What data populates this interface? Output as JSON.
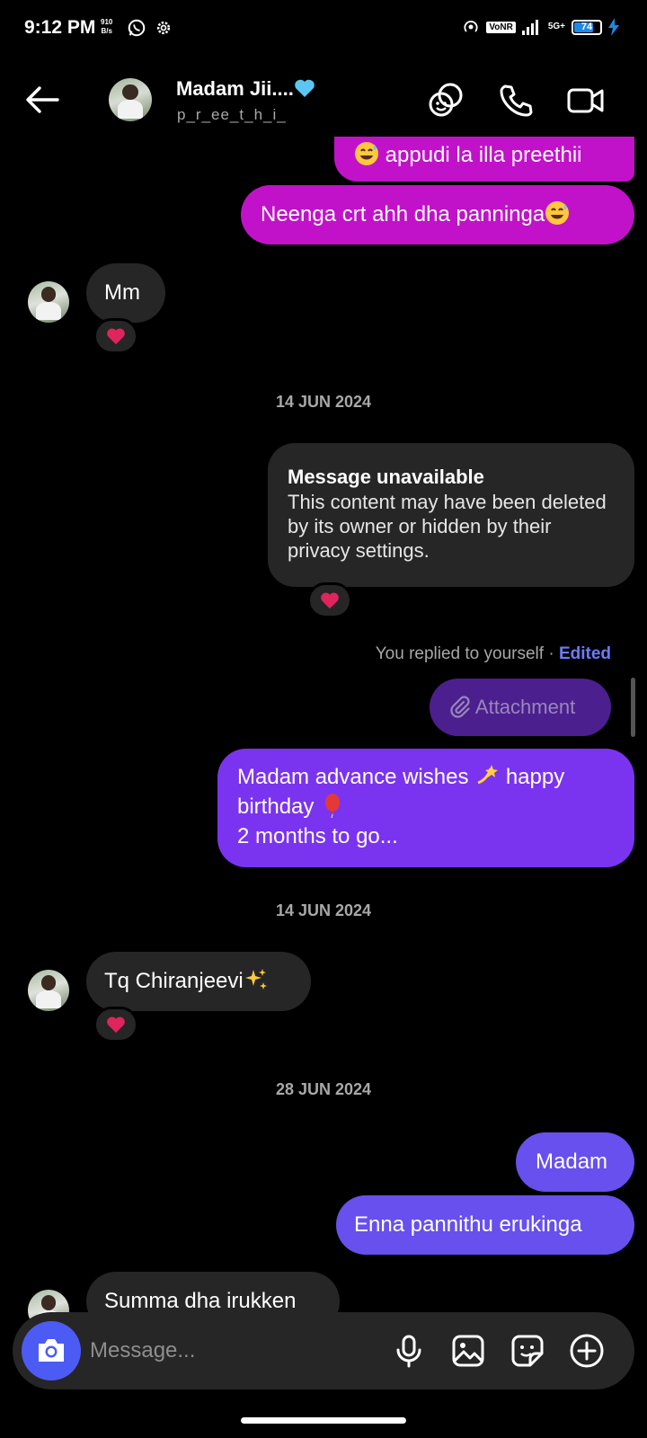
{
  "status_bar": {
    "time": "9:12 PM",
    "net_speed_top": "910",
    "net_speed_bottom": "B/s",
    "volte": "VoNR",
    "network": "5G+",
    "battery": "74"
  },
  "header": {
    "name": "Madam Jii....",
    "username": "p_r_ee_t_h_i_"
  },
  "messages": [
    {
      "text": "appudi la illa preethii"
    },
    {
      "text": "Neenga crt ahh dha panninga"
    },
    {
      "text": "Mm"
    },
    {
      "date": "14 JUN 2024"
    },
    {
      "title": "Message unavailable",
      "text": "This content may have been deleted by its owner or hidden by their privacy settings."
    },
    {
      "reply_note": "You replied to yourself",
      "separator": "·",
      "edited": "Edited"
    },
    {
      "text": "Attachment"
    },
    {
      "line1": "Madam advance wishes",
      "line1b": "happy",
      "line2": "birthday",
      "line3": "2 months to go..."
    },
    {
      "date": "14 JUN 2024"
    },
    {
      "text": "Tq Chiranjeevi"
    },
    {
      "date": "28 JUN 2024"
    },
    {
      "text": "Madam"
    },
    {
      "text": "Enna pannithu erukinga"
    },
    {
      "text": "Summa dha irukken"
    }
  ],
  "composer": {
    "placeholder": "Message..."
  },
  "icons": [
    "back-arrow-icon",
    "sticker-link-icon",
    "phone-icon",
    "video-icon",
    "heart-reaction-icon",
    "paperclip-icon",
    "camera-icon",
    "microphone-icon",
    "gallery-icon",
    "sticker-icon",
    "plus-icon"
  ],
  "colors": {
    "pink_bubble": "#c112c9",
    "purple_bubble": "#7a34f0",
    "blue_bubble": "#6750ee",
    "received_bubble": "#262626",
    "camera_button": "#4d5bf5",
    "edited_link": "#6b7cff"
  }
}
